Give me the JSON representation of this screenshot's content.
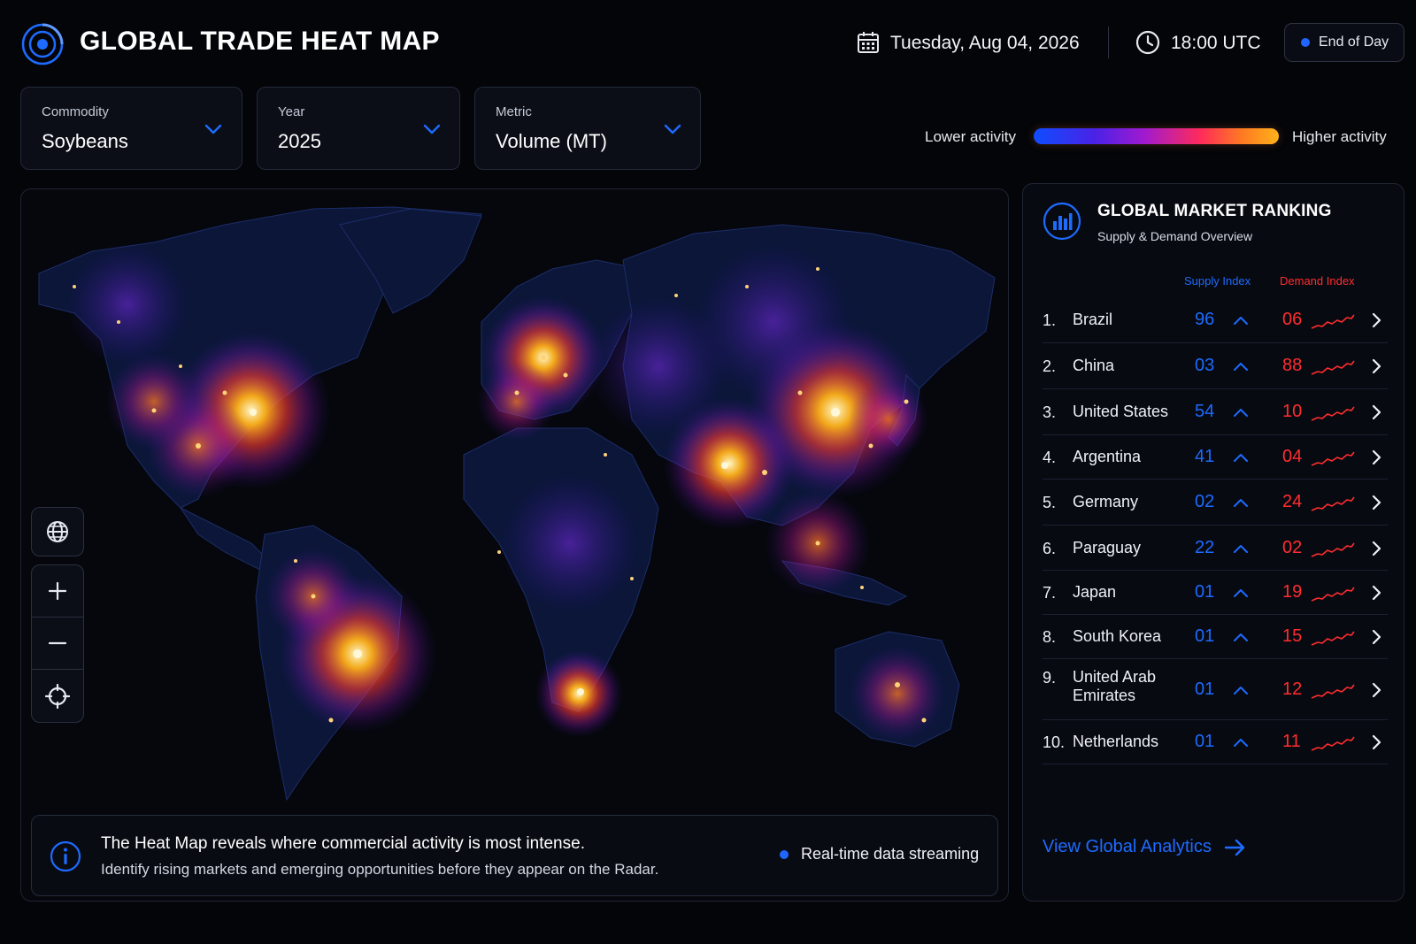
{
  "header": {
    "title": "GLOBAL TRADE HEAT MAP",
    "date": "Tuesday, Aug 04, 2026",
    "time": "18:00 UTC",
    "status_label": "End of Day",
    "logo_icon": "radar-logo-icon",
    "date_icon": "calendar-icon",
    "time_icon": "clock-icon"
  },
  "filters": [
    {
      "label": "Commodity",
      "value": "Soybeans",
      "icon": "chevron-down-icon"
    },
    {
      "label": "Year",
      "value": "2025",
      "icon": "chevron-down-icon"
    },
    {
      "label": "Metric",
      "value": "Volume (MT)",
      "icon": "chevron-down-icon"
    }
  ],
  "legend": {
    "low_label": "Lower activity",
    "high_label": "Higher activity",
    "gradient_colors": [
      "#0f4dff",
      "#4a22e6",
      "#a01ad0",
      "#ff2b5a",
      "#ff7a22",
      "#ffb21a"
    ]
  },
  "map_controls": {
    "globe_icon": "globe-icon",
    "zoom_in_icon": "plus-icon",
    "zoom_out_icon": "minus-icon",
    "locate_icon": "crosshair-icon"
  },
  "info": {
    "line1": "The Heat Map reveals where commercial activity is most intense.",
    "line2": "Identify rising markets and emerging opportunities before they appear on the Radar.",
    "stream_label": "Real-time data streaming",
    "icon": "info-icon"
  },
  "ranking": {
    "title": "GLOBAL MARKET RANKING",
    "subtitle": "Supply & Demand Overview",
    "supply_header": "Supply Index",
    "demand_header": "Demand Index",
    "rows": [
      {
        "rank": "1.",
        "country": "Brazil",
        "supply": "96",
        "demand": "06"
      },
      {
        "rank": "2.",
        "country": "China",
        "supply": "03",
        "demand": "88"
      },
      {
        "rank": "3.",
        "country": "United States",
        "supply": "54",
        "demand": "10"
      },
      {
        "rank": "4.",
        "country": "Argentina",
        "supply": "41",
        "demand": "04"
      },
      {
        "rank": "5.",
        "country": "Germany",
        "supply": "02",
        "demand": "24"
      },
      {
        "rank": "6.",
        "country": "Paraguay",
        "supply": "22",
        "demand": "02"
      },
      {
        "rank": "7.",
        "country": "Japan",
        "supply": "01",
        "demand": "19"
      },
      {
        "rank": "8.",
        "country": "South Korea",
        "supply": "01",
        "demand": "15"
      },
      {
        "rank": "9.",
        "country": "United Arab Emirates",
        "supply": "01",
        "demand": "12"
      },
      {
        "rank": "10.",
        "country": "Netherlands",
        "supply": "01",
        "demand": "11"
      }
    ],
    "link_label": "View Global Analytics",
    "supply_color": "#1d6bff",
    "demand_color": "#ff2d2d"
  }
}
